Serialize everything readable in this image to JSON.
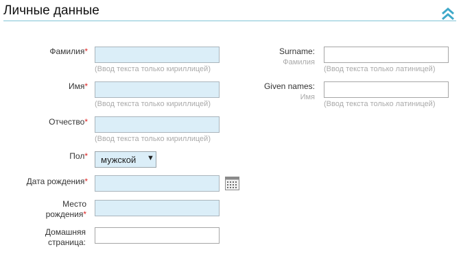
{
  "section": {
    "title": "Личные данные"
  },
  "hints": {
    "cyrillic": "(Ввод текста только кириллицей)",
    "latin": "(Ввод текста только латиницей)"
  },
  "fields": {
    "surname_ru": {
      "label": "Фамилия",
      "req": "*",
      "value": ""
    },
    "name_ru": {
      "label": "Имя",
      "req": "*",
      "value": ""
    },
    "patronymic": {
      "label": "Отчество",
      "req": "*",
      "value": ""
    },
    "gender": {
      "label": "Пол",
      "req": "*",
      "value": "мужской",
      "arrow": "▼"
    },
    "birth_date": {
      "label": "Дата рождения",
      "req": "*",
      "value": ""
    },
    "birth_place": {
      "label_line1": "Место",
      "label_line2": "рождения",
      "req": "*",
      "value": ""
    },
    "homepage": {
      "label_line1": "Домашняя",
      "label_line2": "страница:",
      "value": ""
    },
    "surname_en": {
      "label": "Surname:",
      "sub": "Фамилия",
      "value": ""
    },
    "given_names": {
      "label": "Given names:",
      "sub": "Имя",
      "value": ""
    }
  },
  "colors": {
    "required_field_bg": "#dbeef8",
    "accent": "#3fa9c9",
    "required_marker": "#dd2222"
  },
  "icons": {
    "collapse": "double-chevron-up-icon",
    "calendar": "calendar-icon"
  }
}
